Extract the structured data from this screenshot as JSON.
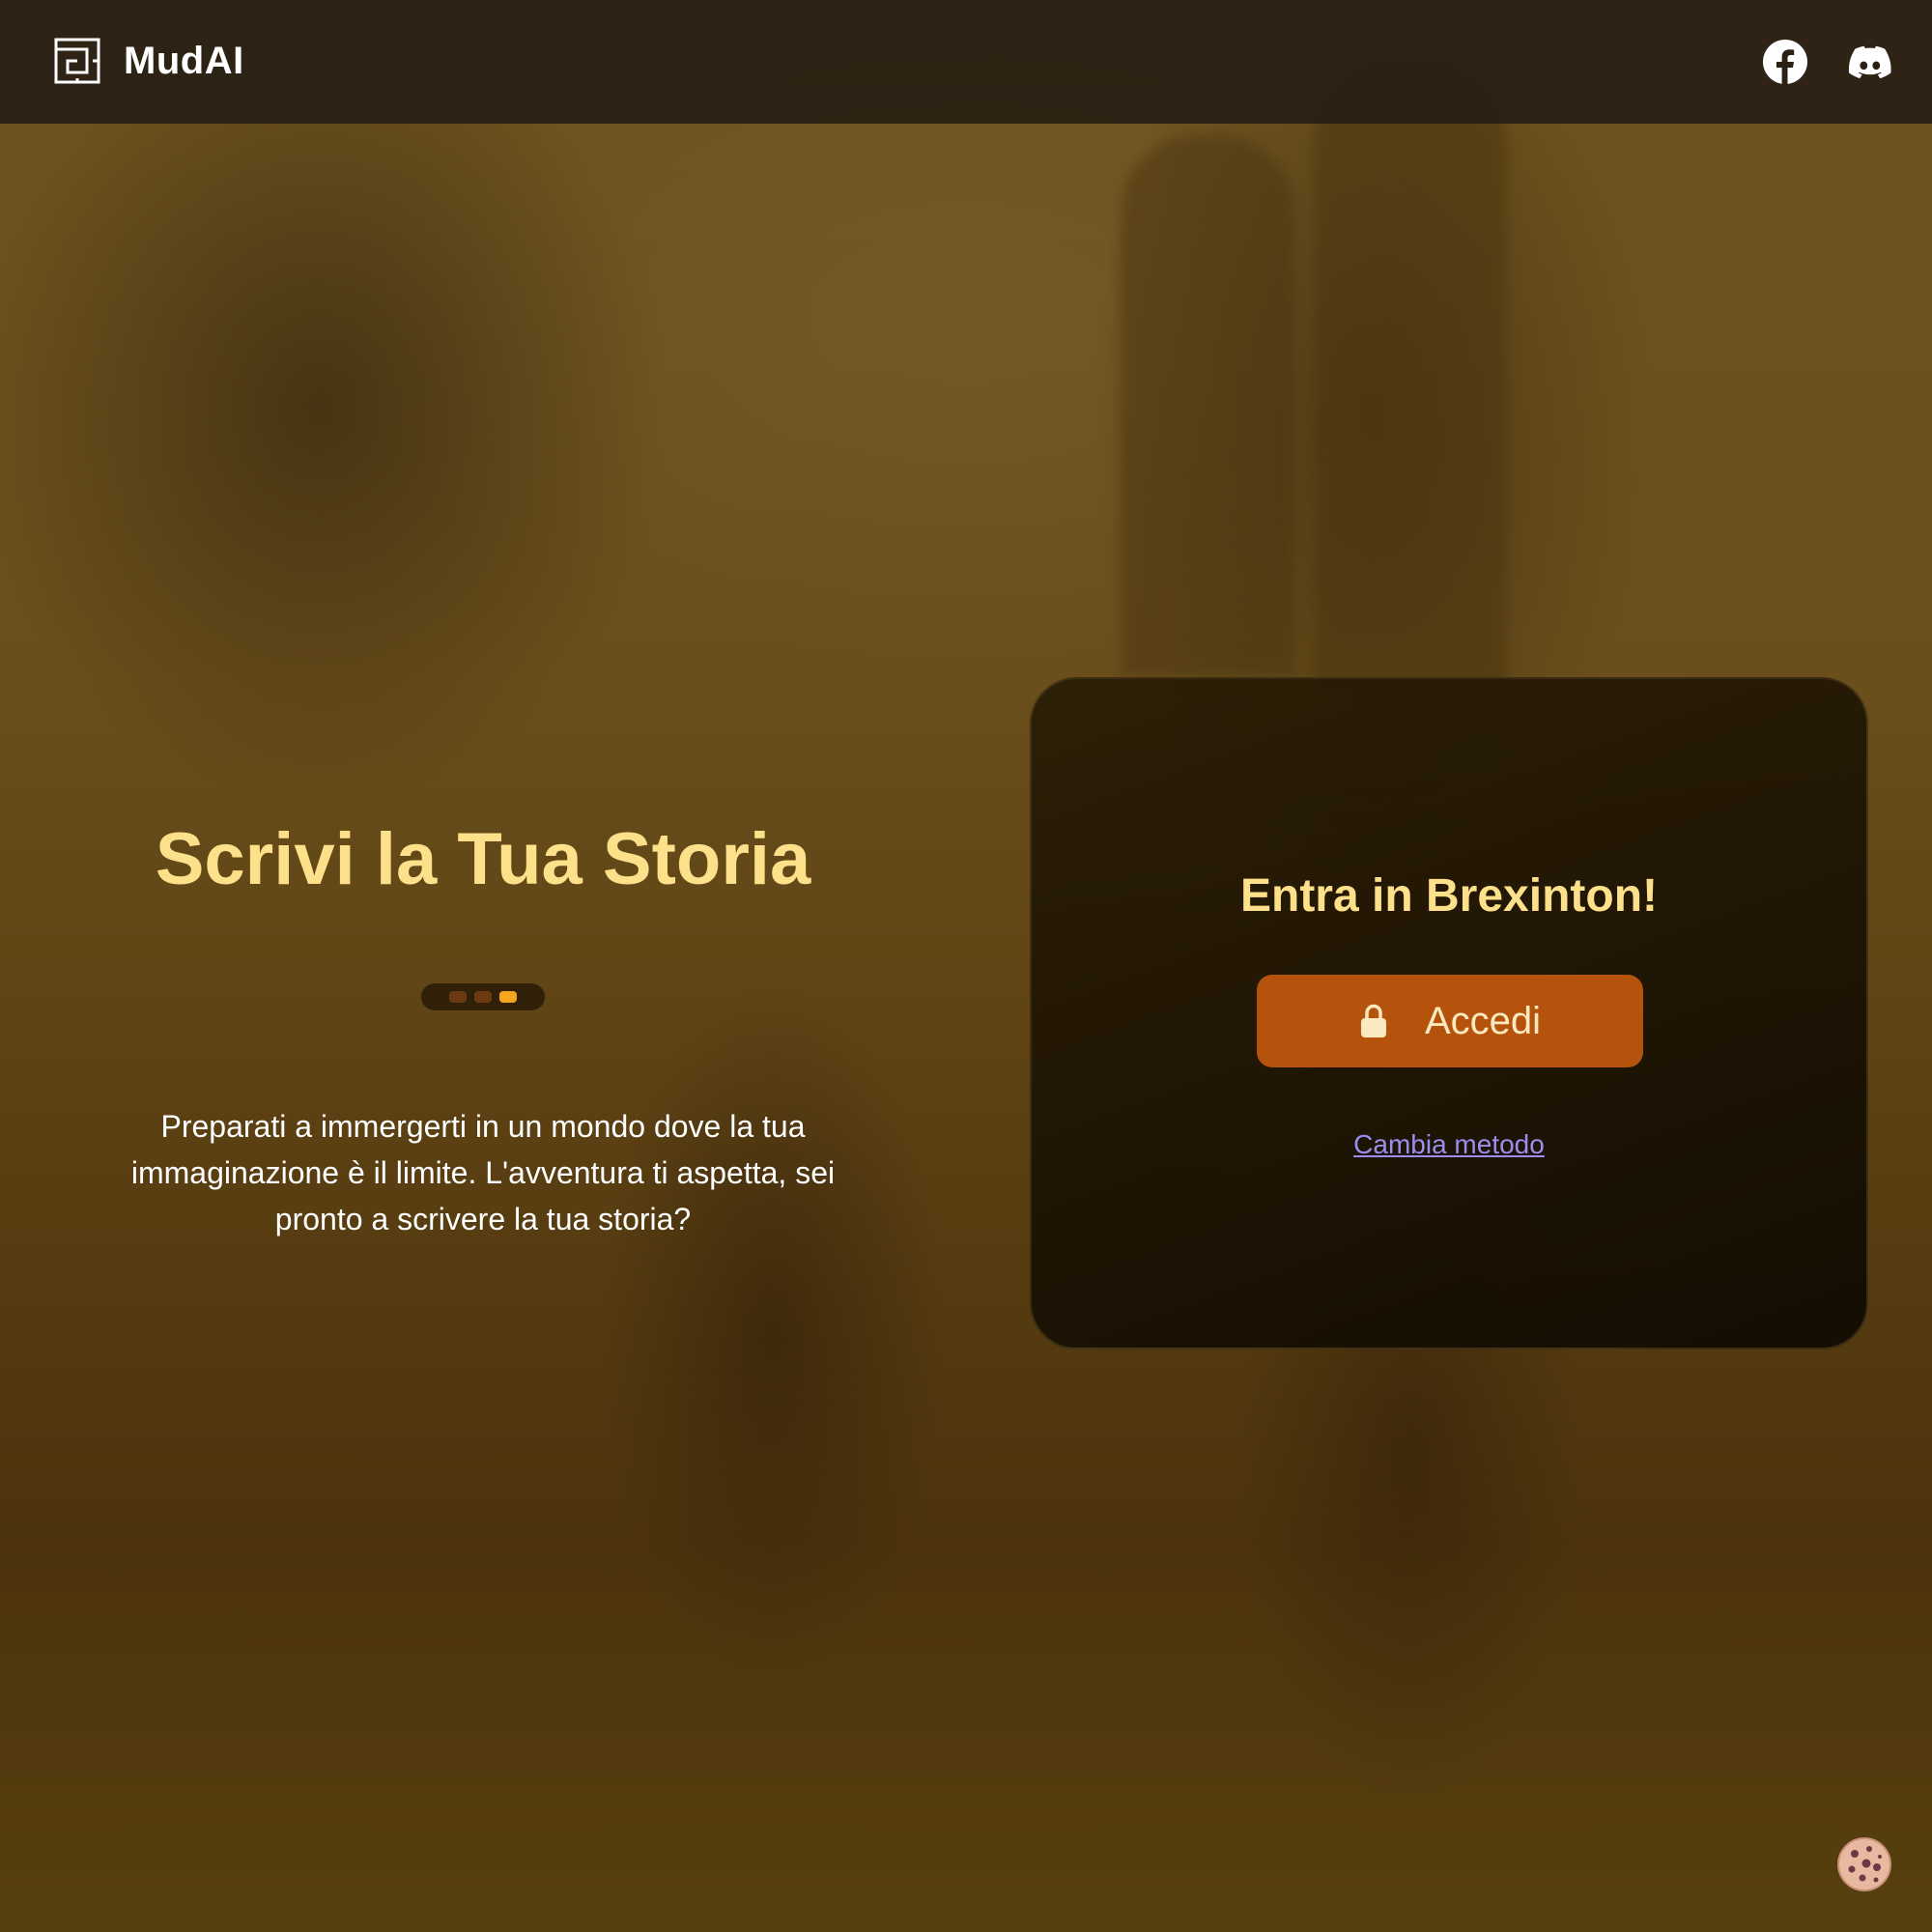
{
  "app": {
    "name": "MudAI"
  },
  "header": {
    "logo_icon": "maze-logo-icon",
    "social": [
      {
        "name": "facebook-icon"
      },
      {
        "name": "discord-icon"
      }
    ]
  },
  "hero": {
    "title": "Scrivi la Tua Storia",
    "carousel": {
      "count": 3,
      "active_index": 2
    },
    "description": "Preparati a immergerti in un mondo dove la tua immaginazione è il limite. L'avventura ti aspetta, sei pronto a scrivere la tua storia?"
  },
  "login_card": {
    "title": "Entra in Brexinton!",
    "login_button": {
      "label": "Accedi",
      "icon": "lock-icon"
    },
    "change_method_link": "Cambia metodo"
  },
  "cookie_button": {
    "icon": "cookie-icon"
  },
  "colors": {
    "accent_title": "#fde08a",
    "button": "#b5530c",
    "link": "#9b8ef0",
    "dot_active": "#f4a71e",
    "dot_inactive": "#6b3a12"
  }
}
